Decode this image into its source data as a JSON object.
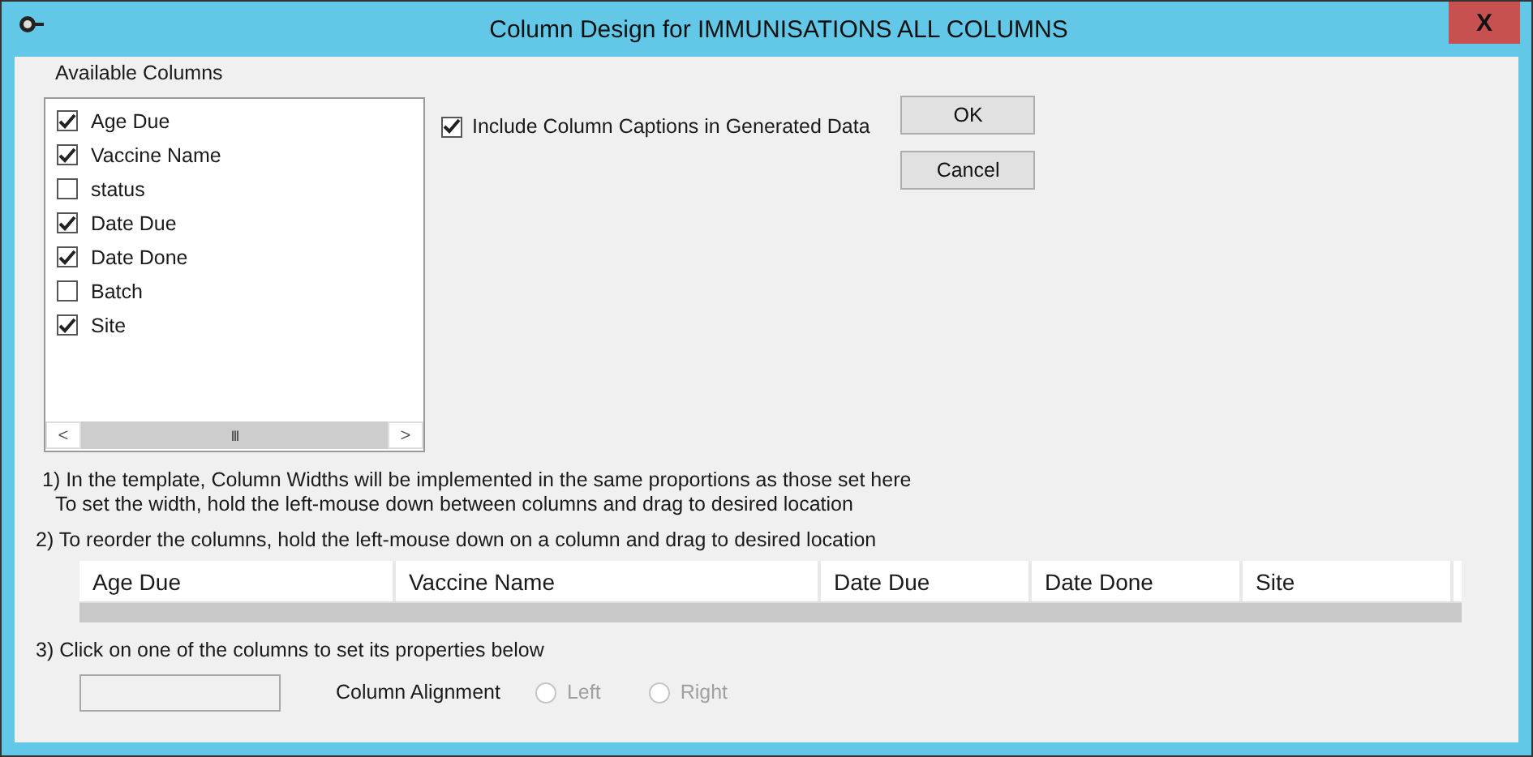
{
  "window": {
    "title": "Column Design for IMMUNISATIONS ALL COLUMNS",
    "close": "X"
  },
  "available_columns": {
    "label": "Available Columns",
    "items": [
      {
        "label": "Age Due",
        "checked": true
      },
      {
        "label": "Vaccine Name",
        "checked": true
      },
      {
        "label": "status",
        "checked": false
      },
      {
        "label": "Date Due",
        "checked": true
      },
      {
        "label": "Date Done",
        "checked": true
      },
      {
        "label": "Batch",
        "checked": false
      },
      {
        "label": "Site",
        "checked": true
      }
    ],
    "scrollbar": {
      "left": "<",
      "thumb": "III",
      "right": ">"
    }
  },
  "include_captions": {
    "label": "Include Column Captions in Generated Data",
    "checked": true
  },
  "buttons": [
    "OK",
    "Cancel"
  ],
  "instructions": [
    "1) In the template, Column Widths will be implemented in the same proportions as those set here",
    "To set the width, hold the left-mouse down between columns and drag to desired location",
    "2) To reorder the columns, hold the left-mouse down on a column and drag to desired location"
  ],
  "columns": [
    "Age Due",
    "Vaccine Name",
    "Date Due",
    "Date Done",
    "Site"
  ],
  "step3": "3) Click on one of the columns to set its properties below",
  "alignment": {
    "label": "Column Alignment",
    "options": [
      {
        "label": "Left",
        "selected": false,
        "disabled": true
      },
      {
        "label": "Right",
        "selected": false,
        "disabled": true
      }
    ]
  }
}
